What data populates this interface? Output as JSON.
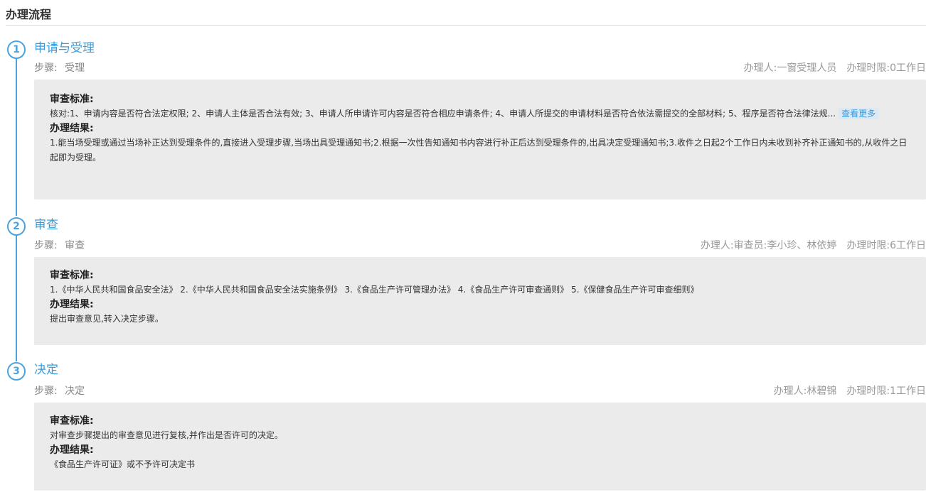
{
  "section": {
    "title": "办理流程"
  },
  "colors": {
    "accent": "#4aa3df",
    "card_bg": "#ebebeb"
  },
  "steps": [
    {
      "number": "1",
      "name": "申请与受理",
      "step_label": "步骤:",
      "step_value": "受理",
      "handler_label": "办理人:",
      "handler_value": "一窗受理人员",
      "limit_label": "办理时限:",
      "limit_value": "0工作日",
      "review_title": "审查标准:",
      "review_text": "核对:1、申请内容是否符合法定权限; 2、申请人主体是否合法有效; 3、申请人所申请许可内容是否符合相应申请条件; 4、申请人所提交的申请材料是否符合依法需提交的全部材料; 5、程序是否符合法律法规...",
      "more_label": "查看更多",
      "result_title": "办理结果:",
      "result_text": "1.能当场受理或通过当场补正达到受理条件的,直接进入受理步骤,当场出具受理通知书;2.根据一次性告知通知书内容进行补正后达到受理条件的,出具决定受理通知书;3.收件之日起2个工作日内未收到补齐补正通知书的,从收件之日起即为受理。"
    },
    {
      "number": "2",
      "name": "审查",
      "step_label": "步骤:",
      "step_value": "审查",
      "handler_label": "办理人:",
      "handler_value": "审查员:李小珍、林依婷",
      "limit_label": "办理时限:",
      "limit_value": "6工作日",
      "review_title": "审查标准:",
      "review_text": "1.《中华人民共和国食品安全法》 2.《中华人民共和国食品安全法实施条例》 3.《食品生产许可管理办法》 4.《食品生产许可审查通则》 5.《保健食品生产许可审查细则》",
      "result_title": "办理结果:",
      "result_text": "提出审查意见,转入决定步骤。"
    },
    {
      "number": "3",
      "name": "决定",
      "step_label": "步骤:",
      "step_value": "决定",
      "handler_label": "办理人:",
      "handler_value": "林碧锦",
      "limit_label": "办理时限:",
      "limit_value": "1工作日",
      "review_title": "审查标准:",
      "review_text": "对审查步骤提出的审查意见进行复核,并作出是否许可的决定。",
      "result_title": "办理结果:",
      "result_text": "《食品生产许可证》或不予许可决定书"
    }
  ]
}
